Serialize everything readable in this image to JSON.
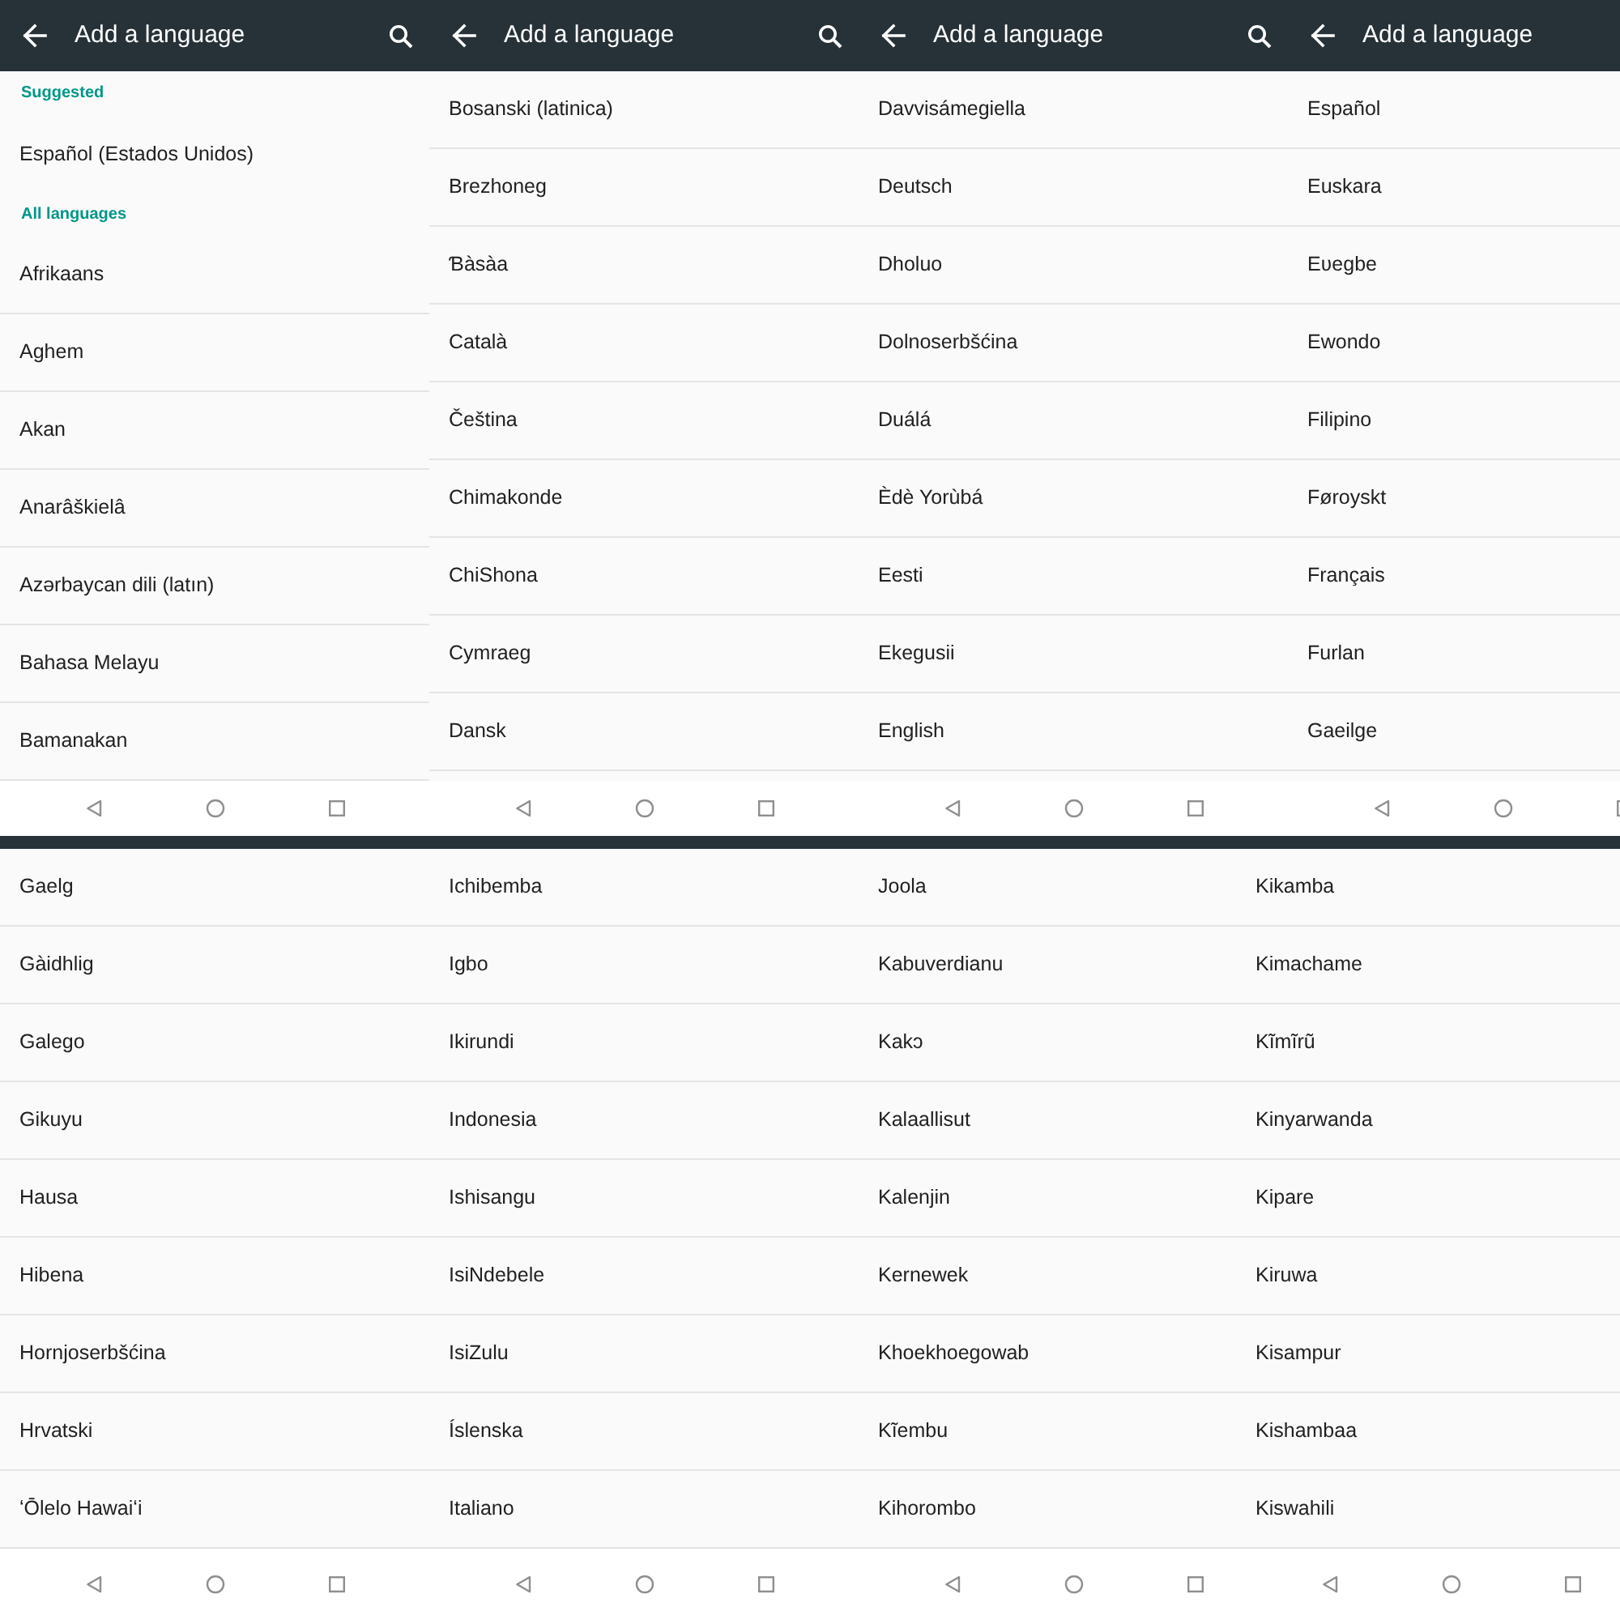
{
  "rows": [
    {
      "screens": [
        {
          "app_bar": {
            "title": "Add a language",
            "search_button": true
          },
          "sections": [
            {
              "header": "Suggested",
              "items": [
                "Español (Estados Unidos)"
              ]
            },
            {
              "header": "All languages",
              "items": [
                "Afrikaans",
                "Aghem",
                "Akan",
                "Anarâškielâ",
                "Azərbaycan dili (latın)",
                "Bahasa Melayu",
                "Bamanakan"
              ]
            }
          ]
        },
        {
          "app_bar": {
            "title": "Add a language",
            "search_button": true
          },
          "sections": [
            {
              "items": [
                "Bosanski (latinica)",
                "Brezhoneg",
                "Ɓàsàa",
                "Català",
                "Čeština",
                "Chimakonde",
                "ChiShona",
                "Cymraeg",
                "Dansk"
              ]
            }
          ]
        },
        {
          "app_bar": {
            "title": "Add a language",
            "search_button": true
          },
          "sections": [
            {
              "items": [
                "Davvisámegiella",
                "Deutsch",
                "Dholuo",
                "Dolnoserbšćina",
                "Duálá",
                "Èdè Yorùbá",
                "Eesti",
                "Ekegusii",
                "English"
              ]
            }
          ]
        },
        {
          "app_bar": {
            "title": "Add a language",
            "search_button": false
          },
          "sections": [
            {
              "items": [
                "Español",
                "Euskara",
                "Eʋegbe",
                "Ewondo",
                "Filipino",
                "Føroyskt",
                "Français",
                "Furlan",
                "Gaeilge"
              ]
            }
          ]
        }
      ]
    },
    {
      "screens": [
        {
          "sections": [
            {
              "items": [
                "Gaelg",
                "Gàidhlig",
                "Galego",
                "Gikuyu",
                "Hausa",
                "Hibena",
                "Hornjoserbšćina",
                "Hrvatski",
                "ʻŌlelo Hawaiʻi"
              ]
            }
          ]
        },
        {
          "sections": [
            {
              "items": [
                "Ichibemba",
                "Igbo",
                "Ikirundi",
                "Indonesia",
                "Ishisangu",
                "IsiNdebele",
                "IsiZulu",
                "Íslenska",
                "Italiano"
              ]
            }
          ]
        },
        {
          "sections": [
            {
              "items": [
                "Joola",
                "Kabuverdianu",
                "Kakɔ",
                "Kalaallisut",
                "Kalenjin",
                "Kernewek",
                "Khoekhoegowab",
                "Kĩembu",
                "Kihorombo"
              ]
            }
          ]
        },
        {
          "sections": [
            {
              "items": [
                "Kikamba",
                "Kimachame",
                "Kĩmĩrũ",
                "Kinyarwanda",
                "Kipare",
                "Kiruwa",
                "Kisampur",
                "Kishambaa",
                "Kiswahili"
              ]
            }
          ]
        }
      ]
    }
  ]
}
